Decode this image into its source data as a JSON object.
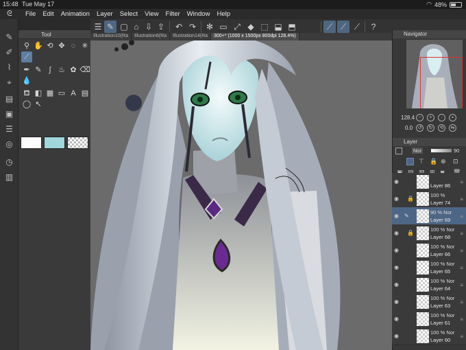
{
  "status": {
    "time": "15:48",
    "date": "Tue May 17",
    "battery": "48%",
    "battery_level": 0.48
  },
  "menu": {
    "items": [
      "File",
      "Edit",
      "Animation",
      "Layer",
      "Select",
      "View",
      "Filter",
      "Window",
      "Help"
    ]
  },
  "tool_panel": {
    "tab_label": "Tool"
  },
  "doc_tabs": [
    "Illustration10(Ra",
    "Illustration6(Ra",
    "Illustration14(Ra",
    "300+* (1000 x 1500px 800dpi 128.4%)"
  ],
  "navigator": {
    "title": "Navigator",
    "zoom": "128.4",
    "rotation": "0.0"
  },
  "layer_panel": {
    "title": "Layer",
    "blend_mode": "Nor",
    "opacity": "90"
  },
  "layers": [
    {
      "opacity": "",
      "name": "Layer 86",
      "locked": false,
      "selected": false
    },
    {
      "opacity": "100 %",
      "name": "Layer 74",
      "locked": true,
      "selected": false
    },
    {
      "opacity": "90 % Nor",
      "name": "Layer 69",
      "locked": false,
      "selected": true
    },
    {
      "opacity": "100 % Nor",
      "name": "Layer 68",
      "locked": true,
      "selected": false
    },
    {
      "opacity": "100 % Nor",
      "name": "Layer 66",
      "locked": false,
      "selected": false
    },
    {
      "opacity": "100 % Nor",
      "name": "Layer 65",
      "locked": false,
      "selected": false
    },
    {
      "opacity": "100 % Nor",
      "name": "Layer 64",
      "locked": false,
      "selected": false
    },
    {
      "opacity": "100 % Nor",
      "name": "Layer 63",
      "locked": false,
      "selected": false
    },
    {
      "opacity": "100 % Nor",
      "name": "Layer 61",
      "locked": false,
      "selected": false
    },
    {
      "opacity": "100 % Nor",
      "name": "Layer 60",
      "locked": false,
      "selected": false
    }
  ],
  "swatch_colors": {
    "main": "#ffffff",
    "sub": "#9fd7dc"
  },
  "accent": "#4d6686"
}
